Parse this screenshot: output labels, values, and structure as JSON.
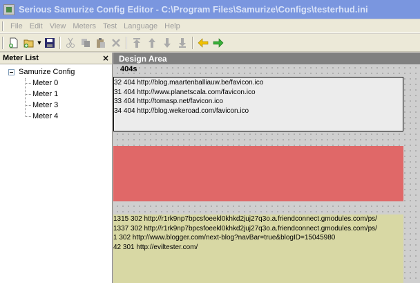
{
  "window": {
    "title": "Serious Samurize Config Editor - C:\\Program Files\\Samurize\\Configs\\testerhud.ini"
  },
  "menu": [
    "File",
    "Edit",
    "View",
    "Meters",
    "Test",
    "Language",
    "Help"
  ],
  "toolbar": {
    "icons": [
      "new-icon",
      "open-icon",
      "save-icon",
      "cut-icon",
      "copy-icon",
      "paste-icon",
      "delete-icon",
      "move-top-icon",
      "move-up-icon",
      "move-down-icon",
      "move-bottom-icon",
      "arrow-left-icon",
      "arrow-right-icon"
    ]
  },
  "sidebar": {
    "title": "Meter List",
    "close": "×",
    "root": "Samurize Config",
    "items": [
      "Meter 0",
      "Meter 1",
      "Meter 3",
      "Meter 4"
    ]
  },
  "design": {
    "title": "Design Area",
    "meter_label": "404s",
    "box1_lines": [
      "32 404 http://blog.maartenballiauw.be/favicon.ico",
      "31 404 http://www.planetscala.com/favicon.ico",
      "33 404 http://tomasp.net/favicon.ico",
      "34 404 http://blog.wekeroad.com/favicon.ico"
    ],
    "box3_lines": [
      "1315 302 http://r1rk9np7bpcsfoeekl0khkd2juj27q3o.a.friendconnect.gmodules.com/ps/",
      "1337 302 http://r1rk9np7bpcsfoeekl0khkd2juj27q3o.a.friendconnect.gmodules.com/ps/",
      "1 302 http://www.blogger.com/next-blog?navBar=true&blogID=15045980",
      "42 301 http://eviltester.com/"
    ]
  },
  "colors": {
    "title_bar": "#7a96df",
    "meter_red": "#e06868",
    "meter_khaki": "#d8d8a4",
    "design_header": "#808080"
  }
}
